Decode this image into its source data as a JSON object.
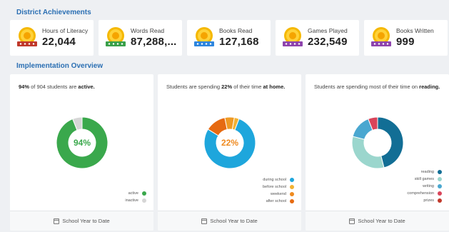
{
  "headings": {
    "achievements": "District Achievements",
    "implementation": "Implementation Overview"
  },
  "stats": [
    {
      "label": "Hours of Literacy",
      "value": "22,044",
      "icon": "medal-hours-icon",
      "ribbon": "#c0392b"
    },
    {
      "label": "Words Read",
      "value": "87,288,...",
      "icon": "medal-words-icon",
      "ribbon": "#3aa04a"
    },
    {
      "label": "Books Read",
      "value": "127,168",
      "icon": "medal-books-icon",
      "ribbon": "#2e86de"
    },
    {
      "label": "Games Played",
      "value": "232,549",
      "icon": "medal-games-icon",
      "ribbon": "#8e44ad"
    },
    {
      "label": "Books Written",
      "value": "999",
      "icon": "medal-written-icon",
      "ribbon": "#8e44ad"
    }
  ],
  "panels": {
    "active": {
      "head_pct": "94%",
      "head_mid": " of 904 students are ",
      "head_bold": "active.",
      "center": "94%",
      "footer": "School Year to Date",
      "legend": [
        {
          "label": "active",
          "color": "#3aa84c"
        },
        {
          "label": "inactive",
          "color": "#d6d6d6"
        }
      ],
      "slices": [
        {
          "value": 94,
          "color": "#3aa84c"
        },
        {
          "value": 6,
          "color": "#d6d6d6"
        }
      ]
    },
    "home": {
      "head_pre": "Students are spending ",
      "head_pct": "22%",
      "head_mid": " of their time ",
      "head_bold": "at home.",
      "center": "22%",
      "footer": "School Year to Date",
      "legend": [
        {
          "label": "during school",
          "color": "#1ea6dc"
        },
        {
          "label": "before school",
          "color": "#f2b233"
        },
        {
          "label": "weekend",
          "color": "#ef8a1f"
        },
        {
          "label": "after school",
          "color": "#e66a11"
        }
      ],
      "slices": [
        {
          "value": 78,
          "color": "#1ea6dc"
        },
        {
          "value": 13,
          "color": "#e66a11"
        },
        {
          "value": 6,
          "color": "#ef9a24"
        },
        {
          "value": 3,
          "color": "#f2b233"
        }
      ]
    },
    "activity": {
      "head_pre": "Students are spending most of their time on ",
      "head_bold": "reading.",
      "footer": "School Year to Date",
      "legend": [
        {
          "label": "reading",
          "color": "#126e95"
        },
        {
          "label": "skill games",
          "color": "#9bd6cd"
        },
        {
          "label": "writing",
          "color": "#4aa7d0"
        },
        {
          "label": "comprehension",
          "color": "#d9445a"
        },
        {
          "label": "prizes",
          "color": "#c0392b"
        }
      ],
      "slices": [
        {
          "value": 46,
          "color": "#126e95"
        },
        {
          "value": 33,
          "color": "#9bd6cd"
        },
        {
          "value": 15,
          "color": "#4aa7d0"
        },
        {
          "value": 6,
          "color": "#d9445a"
        }
      ]
    }
  }
}
